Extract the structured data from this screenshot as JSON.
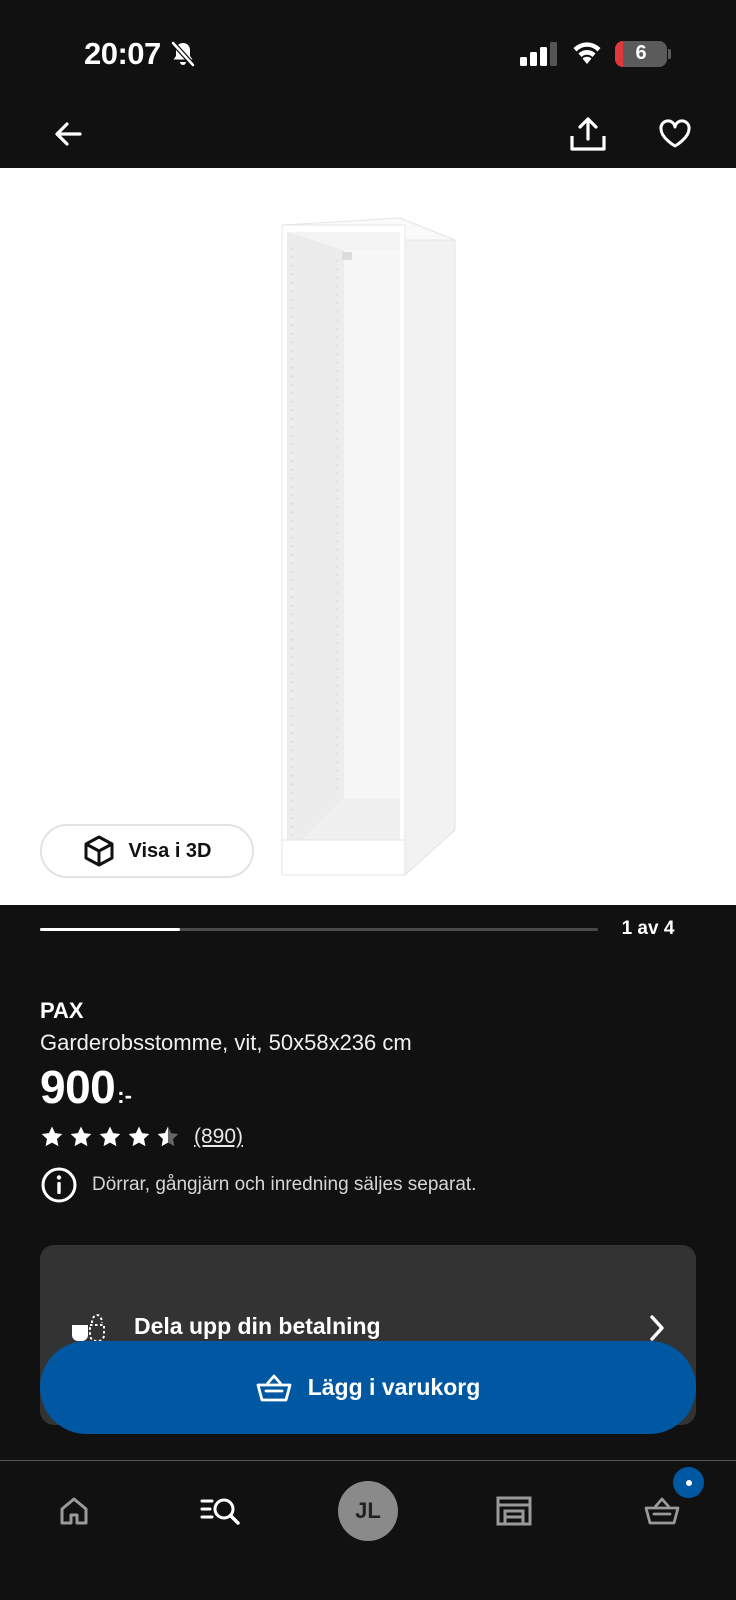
{
  "status_bar": {
    "time": "20:07",
    "battery_level": "6",
    "icons": [
      "bell-off-icon",
      "signal-icon",
      "wifi-icon",
      "battery-icon"
    ]
  },
  "top_nav": {
    "icons": [
      "back-arrow-icon",
      "share-icon",
      "heart-icon"
    ]
  },
  "gallery": {
    "view_3d_label": "Visa i 3D",
    "counter": "1 av 4",
    "progress": 0.25
  },
  "product": {
    "brand": "PAX",
    "description": "Garderobsstomme, vit, 50x58x236 cm",
    "price": "900",
    "price_suffix": ":-",
    "rating": 4.5,
    "review_count": "(890)",
    "info_text": "Dörrar, gångjärn och inredning säljes separat."
  },
  "payment": {
    "label": "Dela upp din betalning"
  },
  "cart_button": {
    "label": "Lägg i varukorg"
  },
  "bottom_nav": {
    "items": [
      "home-icon",
      "search-icon",
      "avatar",
      "store-icon",
      "basket-icon"
    ],
    "avatar_initials": "JL"
  },
  "colors": {
    "background": "#111111",
    "accent_blue": "#0058a3",
    "card_gray": "#333333",
    "battery_red": "#e0373d"
  }
}
